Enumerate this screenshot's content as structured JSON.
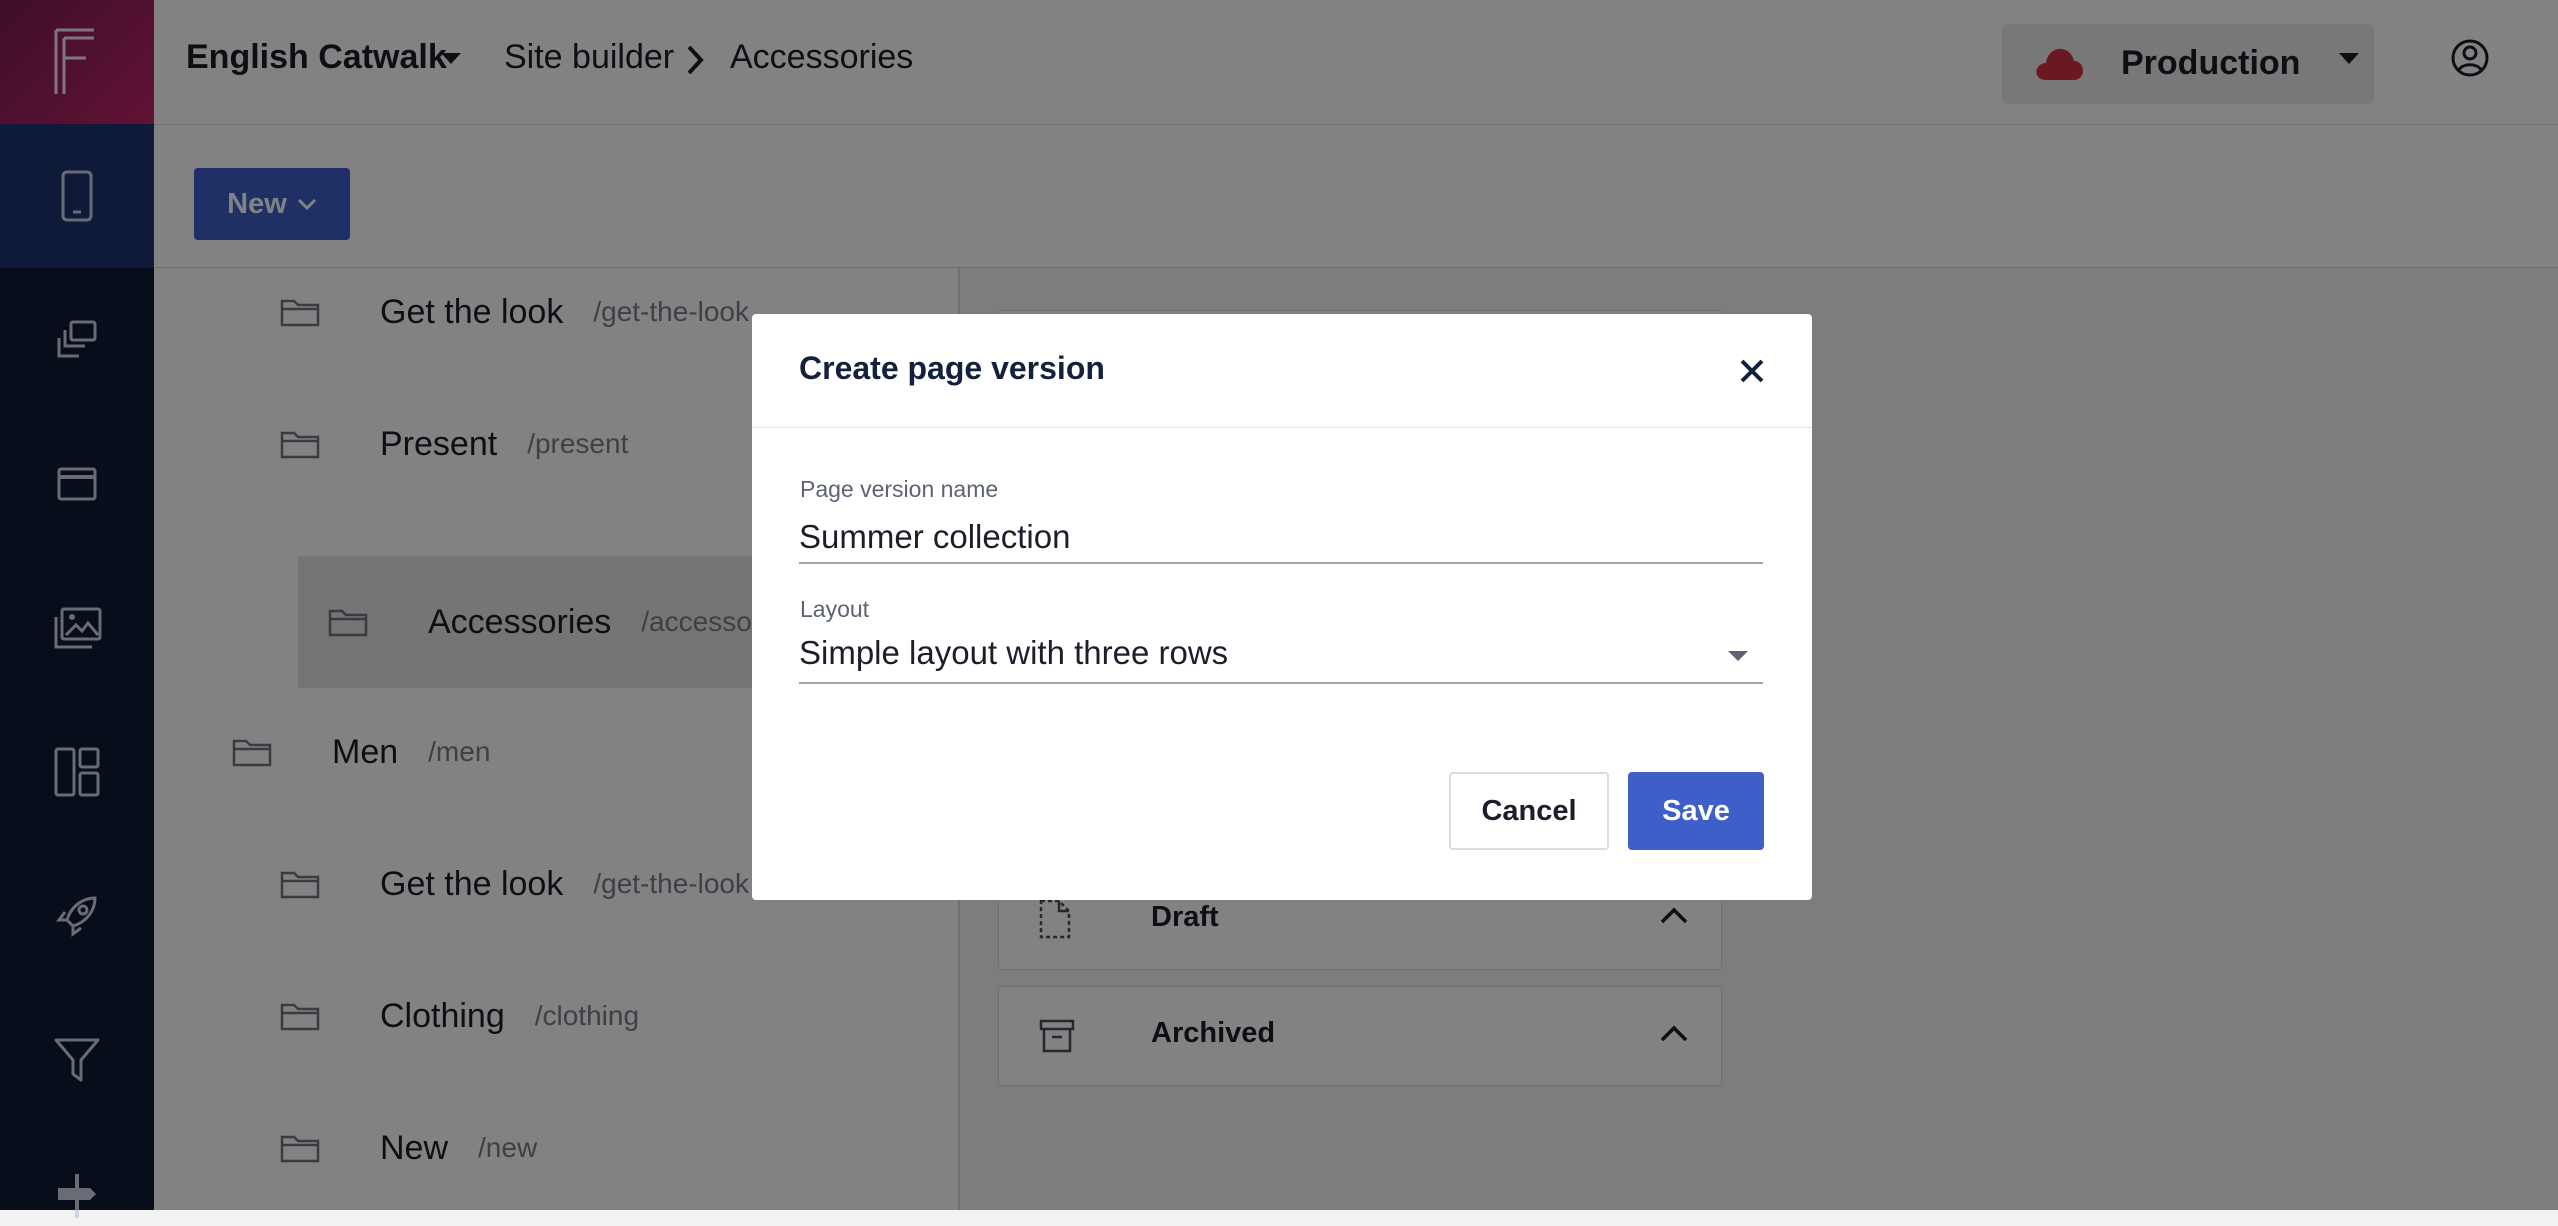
{
  "topbar": {
    "site_name": "English Catwalk",
    "breadcrumb": [
      "Site builder",
      "Accessories"
    ],
    "environment": "Production"
  },
  "toolbar": {
    "new_label": "New"
  },
  "tree": {
    "items": [
      {
        "name": "Get the look",
        "path": "/get-the-look"
      },
      {
        "name": "Present",
        "path": "/present"
      },
      {
        "name": "Accessories",
        "path": "/accessor"
      },
      {
        "name": "Men",
        "path": "/men"
      },
      {
        "name": "Get the look",
        "path": "/get-the-look"
      },
      {
        "name": "Clothing",
        "path": "/clothing"
      },
      {
        "name": "New",
        "path": "/new"
      }
    ]
  },
  "panel": {
    "sections": [
      {
        "label": "Draft"
      },
      {
        "label": "Archived"
      }
    ]
  },
  "modal": {
    "title": "Create page version",
    "name_label": "Page version name",
    "name_value": "Summer collection",
    "layout_label": "Layout",
    "layout_value": "Simple layout with three rows",
    "cancel_label": "Cancel",
    "save_label": "Save"
  },
  "colors": {
    "primary": "#3e5ec8",
    "sidebar": "#0f1b33",
    "sidebar_active": "#1e3470",
    "brand_gradient_start": "#7a1d4f",
    "brand_gradient_end": "#c0246a",
    "env_cloud": "#d0313f"
  },
  "icons": {
    "sidebar": [
      "mobile-icon",
      "copy-pages-icon",
      "window-icon",
      "images-icon",
      "layout-icon",
      "rocket-icon",
      "filter-icon",
      "signpost-icon"
    ],
    "tree": "folder-icon",
    "panel": [
      "draft-file-icon",
      "archive-icon"
    ]
  }
}
